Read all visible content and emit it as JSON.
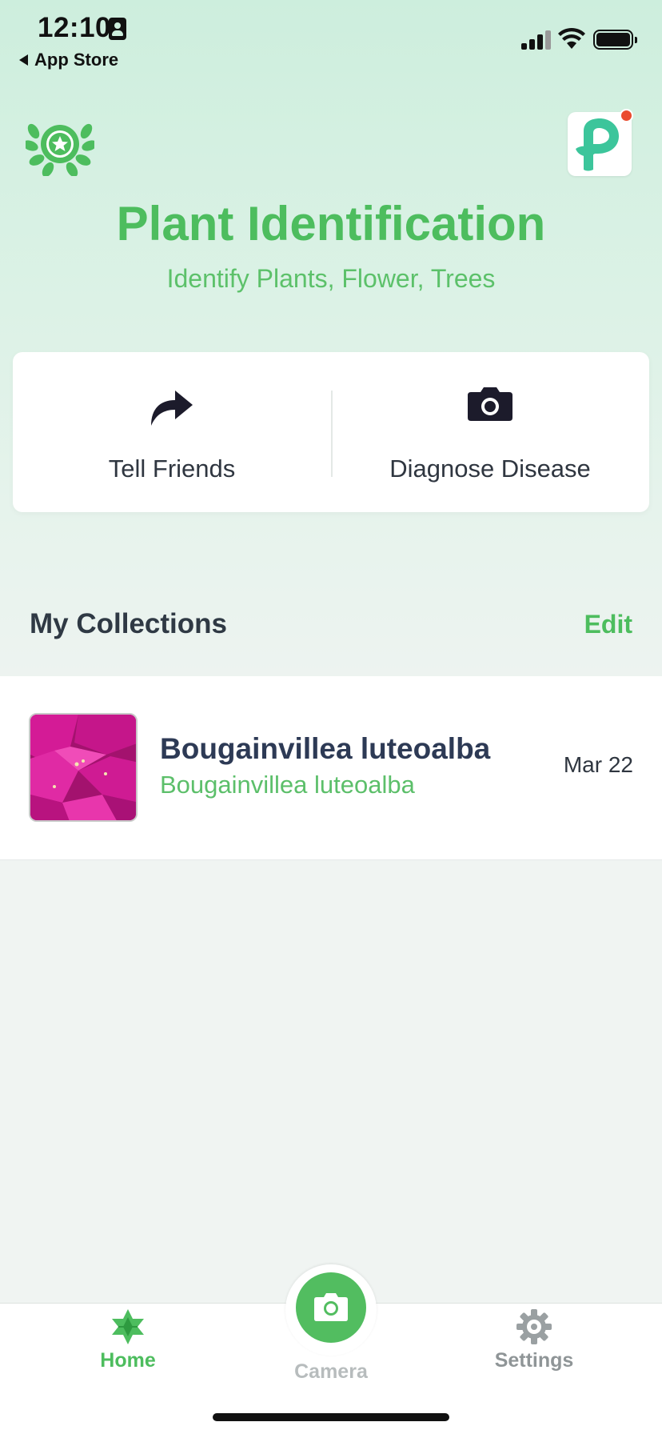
{
  "status_bar": {
    "time": "12:10",
    "back_label": "App Store"
  },
  "header": {
    "title": "Plant Identification",
    "subtitle": "Identify Plants, Flower, Trees"
  },
  "actions": [
    {
      "label": "Tell Friends",
      "icon": "share-arrow-icon"
    },
    {
      "label": "Diagnose Disease",
      "icon": "camera-icon"
    }
  ],
  "collections": {
    "title": "My Collections",
    "edit_label": "Edit",
    "items": [
      {
        "name": "Bougainvillea luteoalba",
        "subtitle": "Bougainvillea luteoalba",
        "date": "Mar 22"
      }
    ]
  },
  "tab_bar": {
    "home": "Home",
    "camera": "Camera",
    "settings": "Settings"
  },
  "colors": {
    "accent": "#4dbd5e",
    "notification": "#ea4b2e",
    "flower": "#c7168f"
  }
}
